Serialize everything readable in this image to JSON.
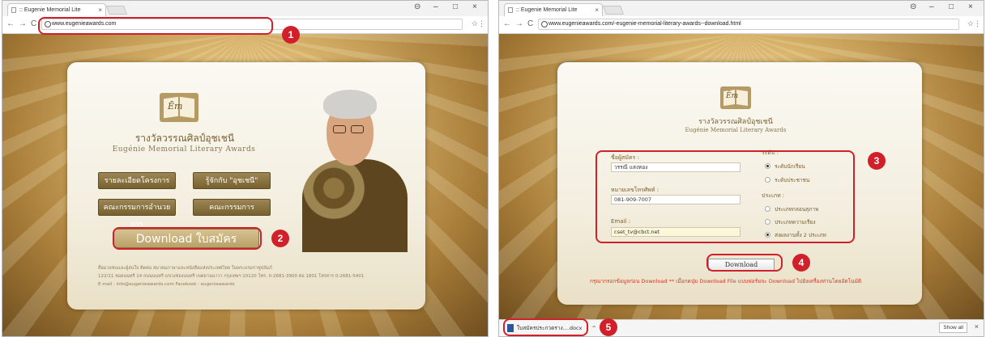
{
  "left": {
    "tab_title": ":: Eugenie Memorial Lite",
    "tab_close": "×",
    "window_controls": {
      "account": "⊝",
      "min": "–",
      "max": "□",
      "close": "×"
    },
    "nav": {
      "back": "←",
      "forward": "→",
      "reload": "C"
    },
    "url": "www.eugenieawards.com",
    "star": "☆",
    "menu": "⋮",
    "site": {
      "logo_signature": "Ēm",
      "title_thai": "รางวัลวรรณศิลป์อุชเชนี",
      "title_eng": "Eugénie Memorial Literary Awards",
      "buttons": [
        "รายละเอียดโครงการ",
        "รู้จักกับ \"อุชเชนี\"",
        "คณะกรรมการอำนวยการ",
        "คณะกรรมการ"
      ],
      "download_label": "Download ใบสมัคร",
      "footer_lines": [
        "สื่อมวลชนและผู้สนใจ ติดต่อ สมาคมภาษาและหนังสือแห่งประเทศไทย ในพระบรมราชูปถัมภ์",
        "122/11 ซอยนนทรี 14 ถนนนนทรี แขวงช่องนนทรี เขตยานนาวา กรุงเทพฯ 10120    โทร. 0-2681-3900 ต่อ 1801 โทรสาร 0-2681-5401",
        "E-mail : info@eugenieawards.com    Facebook : eugenieawards"
      ]
    },
    "badges": [
      "1",
      "2"
    ]
  },
  "right": {
    "tab_title": ":: Eugenie Memorial Lite",
    "tab_close": "×",
    "window_controls": {
      "account": "⊝",
      "min": "–",
      "max": "□",
      "close": "×"
    },
    "nav": {
      "back": "←",
      "forward": "→",
      "reload": "C"
    },
    "url": "www.eugenieawards.com/-eugenie-memorial-literary-awards--download.html",
    "star": "☆",
    "menu": "⋮",
    "site": {
      "logo_signature": "Ēm",
      "title_thai": "รางวัลวรรณศิลป์อุชเชนี",
      "title_eng": "Eugénie Memorial Literary Awards",
      "form": {
        "name_label": "ชื่อผู้สมัคร :",
        "name_value": "วรรณี แสงทอง",
        "phone_label": "หมายเลขโทรศัพท์ :",
        "phone_value": "081-909-7007",
        "email_label": "Email :",
        "email_value": "cset_tv@cbct.net",
        "level_label": "ระดับ :",
        "level_options": [
          "ระดับนักเรียน",
          "ระดับประชาชน"
        ],
        "level_selected": 0,
        "type_label": "ประเภท :",
        "type_options": [
          "ประเภทกลอนสุภาพ",
          "ประเภทความเรียง",
          "ส่งผลงานทั้ง 2 ประเภท"
        ],
        "type_selected": 2
      },
      "download_button": "Download",
      "notice": "กรุณากรอกข้อมูลก่อน Download  ** เมื่อกดปุ่ม Download File แบบฟอร์มจะ Download ไปยังเครื่องท่านโดยอัตโนมัติ"
    },
    "download_bar": {
      "file_name": "ใบสมัครประกวดราง....docx",
      "chevron": "^",
      "show_all": "Show all",
      "close": "×"
    },
    "badges": [
      "3",
      "4",
      "5"
    ]
  }
}
